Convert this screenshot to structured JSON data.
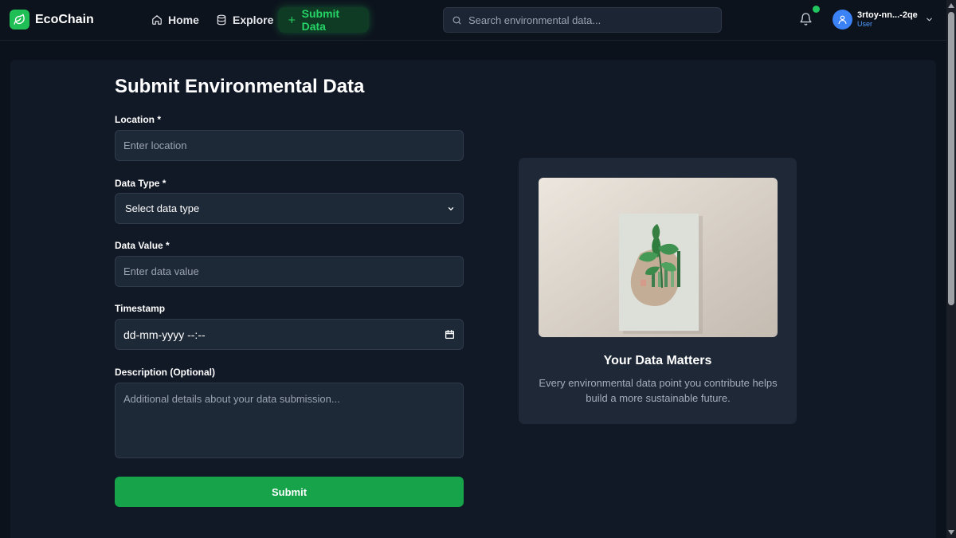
{
  "app": {
    "name": "EcoChain",
    "accent_color": "#22c55e"
  },
  "nav": {
    "home_label": "Home",
    "explore_label": "Explore",
    "submit_label": "Submit Data"
  },
  "search": {
    "placeholder": "Search environmental data..."
  },
  "user": {
    "name": "3rtoy-nn...-2qe",
    "role": "User",
    "has_notification": true
  },
  "form": {
    "title": "Submit Environmental Data",
    "location": {
      "label": "Location *",
      "placeholder": "Enter location",
      "value": ""
    },
    "data_type": {
      "label": "Data Type *",
      "selected": "Select data type"
    },
    "data_value": {
      "label": "Data Value *",
      "placeholder": "Enter data value",
      "value": ""
    },
    "timestamp": {
      "label": "Timestamp",
      "display": "dd-mm-yyyy --:--"
    },
    "description": {
      "label": "Description (Optional)",
      "placeholder": "Additional details about your data submission...",
      "value": ""
    },
    "submit_label": "Submit"
  },
  "info": {
    "title": "Your Data Matters",
    "text": "Every environmental data point you contribute helps build a more sustainable future."
  }
}
